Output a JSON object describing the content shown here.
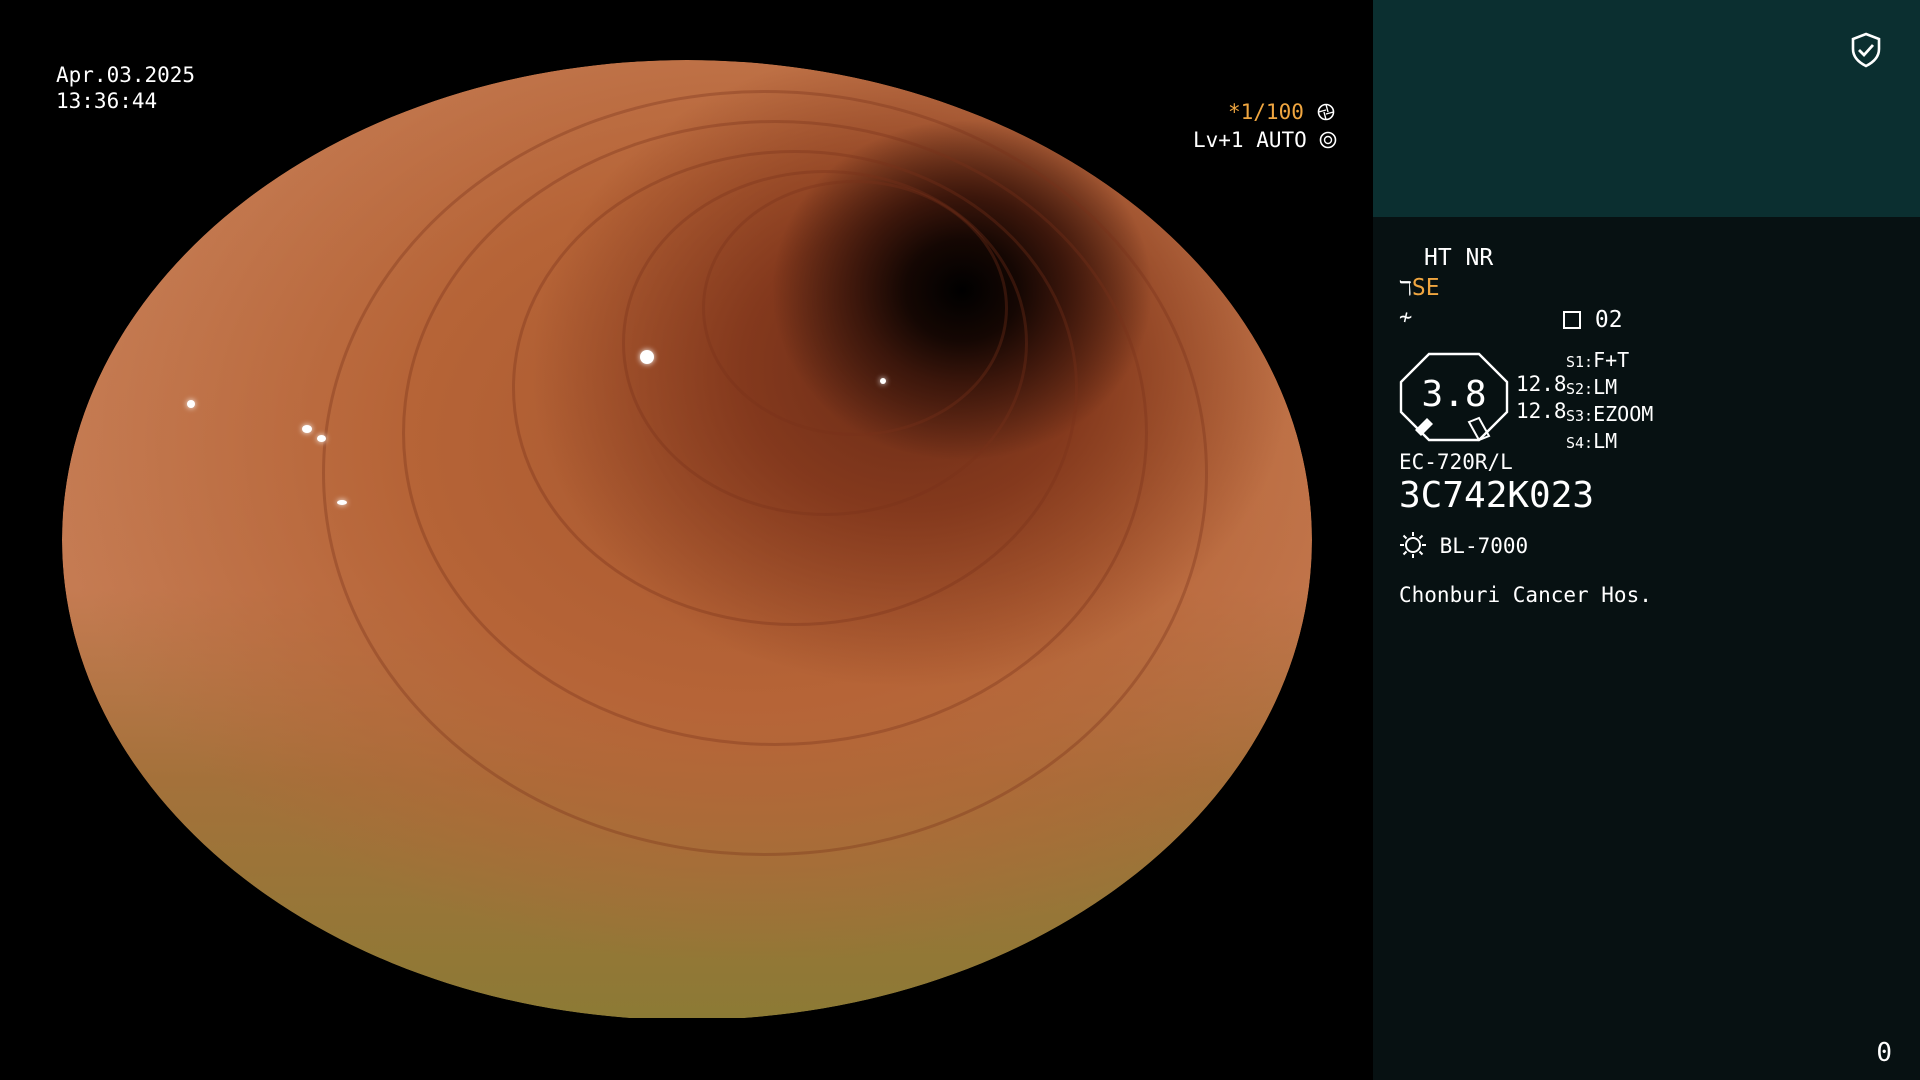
{
  "overlay": {
    "date": "Apr.03.2025",
    "time": "13:36:44",
    "shutter": "*1/100",
    "shutter_icon": "aperture-icon",
    "level": "Lv+1",
    "mode": "AUTO",
    "mode_icon": "iris-icon"
  },
  "panel": {
    "shield_icon": "shield-check-icon",
    "ht_nr": "HT NR",
    "se": "SE",
    "page_code": "02",
    "hex_value": "3.8",
    "mag_top": "12.8",
    "mag_bottom": "12.8",
    "switches": [
      {
        "key": "S1:",
        "value": "F+T"
      },
      {
        "key": "S2:",
        "value": "LM"
      },
      {
        "key": "S3:",
        "value": "EZOOM"
      },
      {
        "key": "S4:",
        "value": "LM"
      }
    ],
    "scope_model": "EC-720R/L",
    "serial": "3C742K023",
    "light_source": "BL-7000",
    "hospital": "Chonburi Cancer Hos.",
    "counter": "0"
  },
  "colors": {
    "panel_bg": "#071112",
    "panel_top": "#0b2f30",
    "accent_orange": "#f0a640"
  }
}
